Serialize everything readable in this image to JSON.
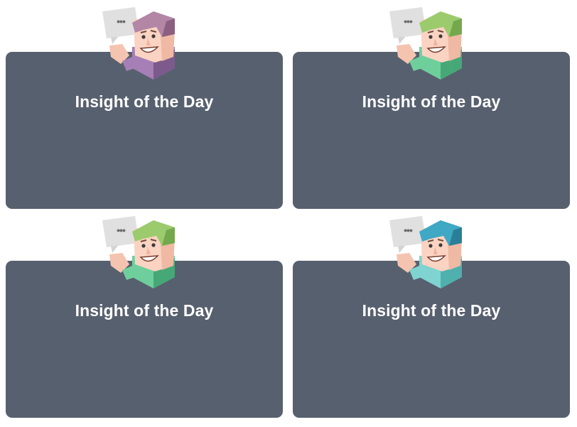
{
  "cards": [
    {
      "title": "Insight of the Day",
      "accent": "#a57fb5",
      "accent_dark": "#7d5a8c",
      "hair": "#b386a6",
      "hair_dark": "#8a5f7f"
    },
    {
      "title": "Insight of the Day",
      "accent": "#6fcf9c",
      "accent_dark": "#46a877",
      "hair": "#9ccb6e",
      "hair_dark": "#74a84d"
    },
    {
      "title": "Insight of the Day",
      "accent": "#6fcf9c",
      "accent_dark": "#46a877",
      "hair": "#9ccb6e",
      "hair_dark": "#74a84d"
    },
    {
      "title": "Insight of the Day",
      "accent": "#7fd3d0",
      "accent_dark": "#4fb0ae",
      "hair": "#3fa8c4",
      "hair_dark": "#2a7f98"
    }
  ],
  "icons": {
    "avatar": "cartoon-character-with-speech-bubble",
    "bubble_text": "•••"
  },
  "colors": {
    "card_background": "#57606f",
    "title_text": "#ffffff",
    "page_background": "#ffffff"
  }
}
